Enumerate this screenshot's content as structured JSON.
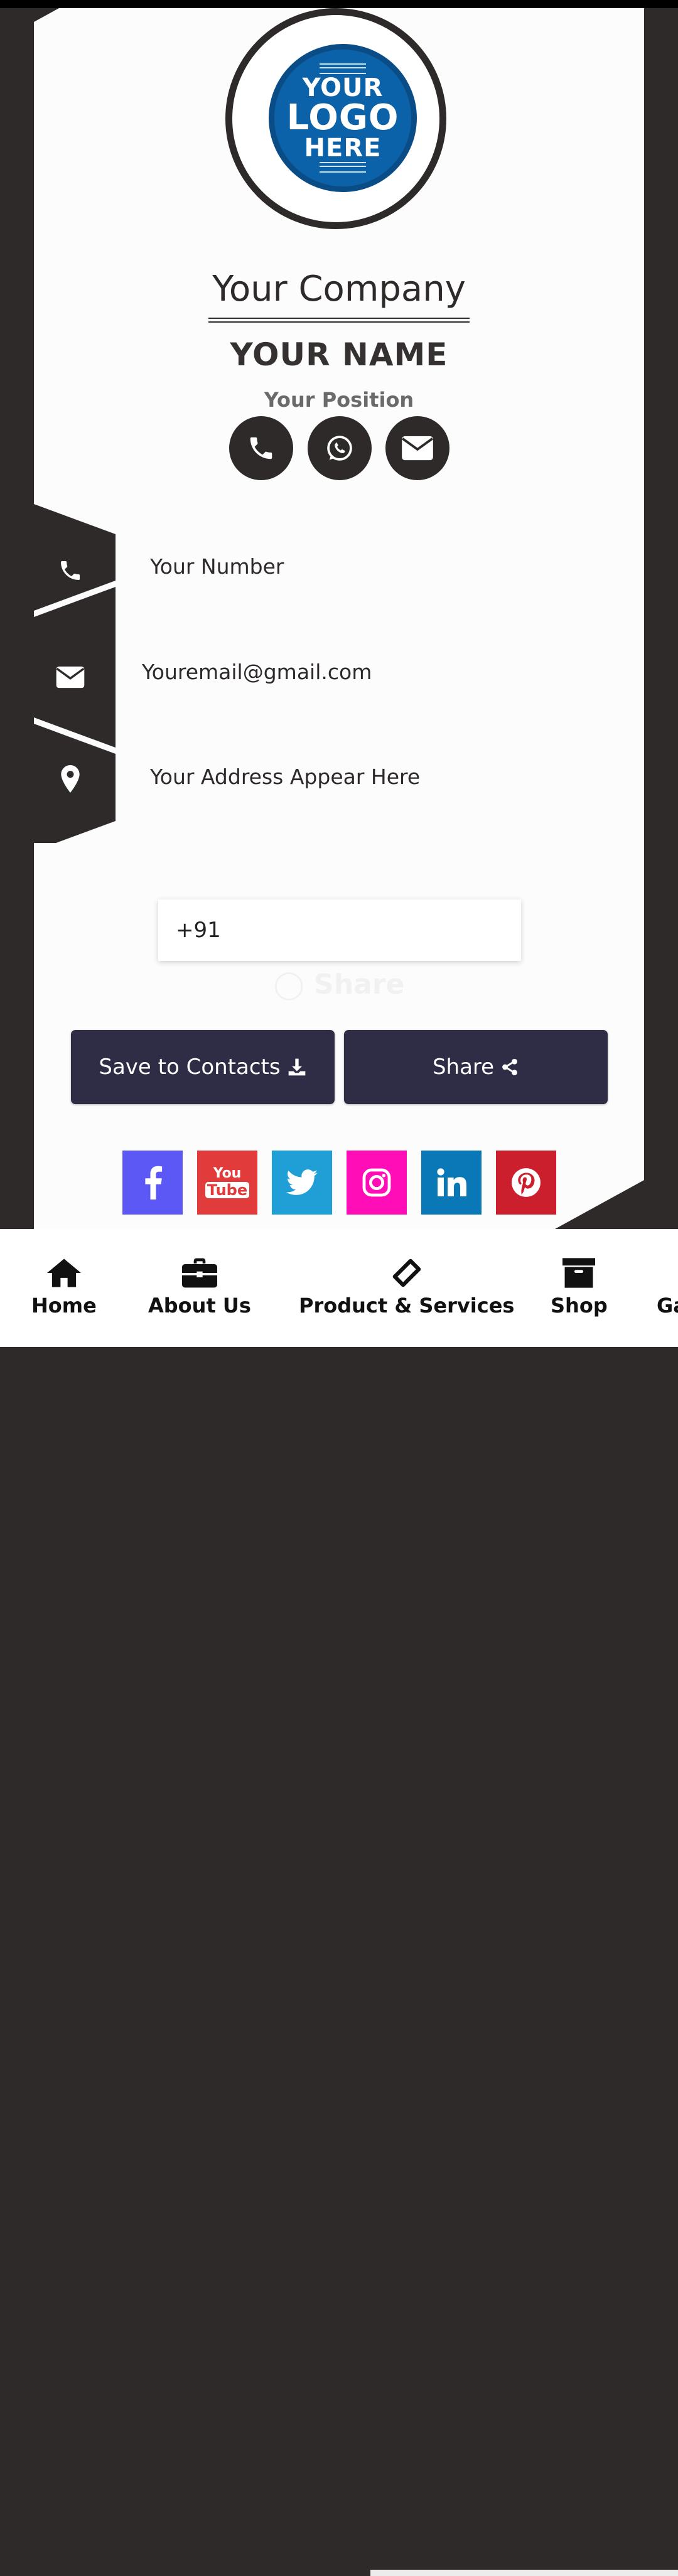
{
  "card": {
    "logo": {
      "line1": "YOUR",
      "line2": "LOGO",
      "line3": "HERE"
    },
    "company": "Your Company",
    "name": "YOUR NAME",
    "position": "Your Position"
  },
  "quick_actions": [
    {
      "icon": "phone-icon"
    },
    {
      "icon": "whatsapp-icon"
    },
    {
      "icon": "envelope-icon"
    }
  ],
  "contact": {
    "number": "Your Number",
    "email": "Youremail@gmail.com",
    "address": "Your Address Appear Here"
  },
  "share_form": {
    "phone_prefix": "+91",
    "ghost_label": "Share"
  },
  "buttons": {
    "save": "Save to Contacts",
    "share": "Share"
  },
  "social": [
    {
      "name": "facebook",
      "color": "#5b58f5"
    },
    {
      "name": "youtube",
      "color": "#e23b3b",
      "text_top": "You",
      "text_bottom": "Tube"
    },
    {
      "name": "twitter",
      "color": "#1f9fd6"
    },
    {
      "name": "instagram",
      "color": "#ff0db7"
    },
    {
      "name": "linkedin",
      "color": "#0a77b6"
    },
    {
      "name": "pinterest",
      "color": "#cc1f2e"
    }
  ],
  "nav": {
    "home": "Home",
    "about": "About Us",
    "products": "Product & Services",
    "shop": "Shop",
    "gallery_partial": "Ga"
  },
  "colors": {
    "dark": "#2e2a2a",
    "button": "#2f2c45",
    "logo_blue": "#0c62a8"
  }
}
